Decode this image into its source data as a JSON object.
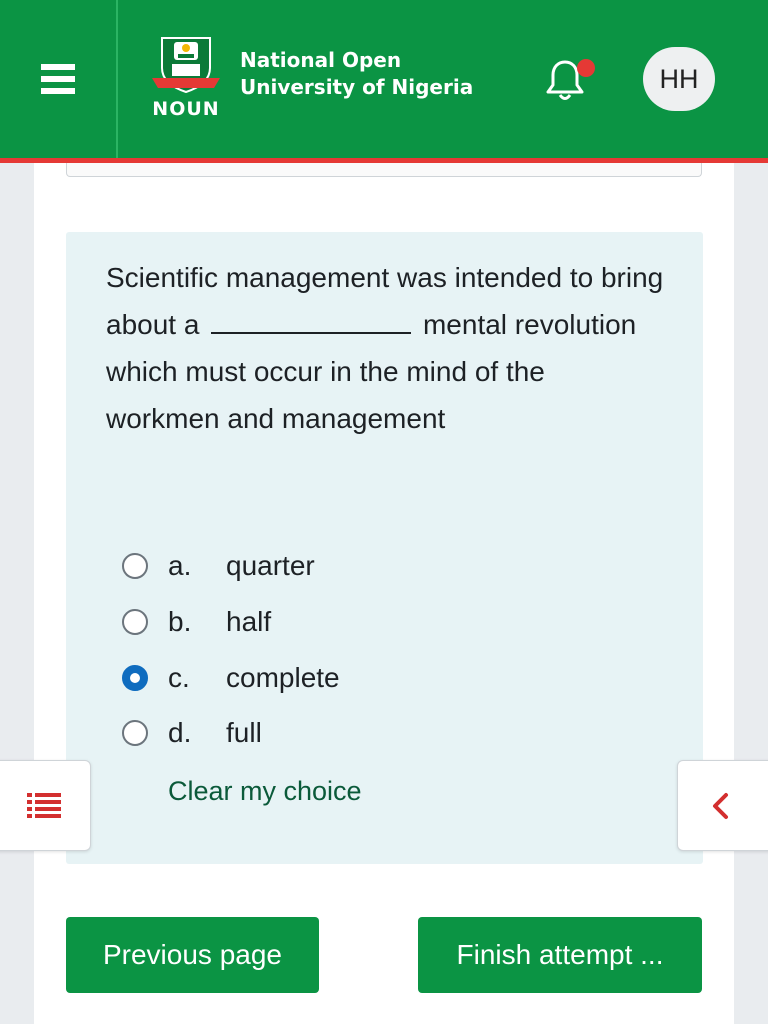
{
  "header": {
    "logo_text": "NOUN",
    "site_name_line1": "National Open",
    "site_name_line2": "University of Nigeria",
    "menu_icon": "hamburger-menu-icon",
    "notification_icon": "bell-icon",
    "user_initials": "HH",
    "colors": {
      "brand_green": "#0b9444",
      "accent_red": "#e53935"
    }
  },
  "question": {
    "text_before": "Scientific management was intended to bring about a",
    "text_after": "mental revolution which must occur in the mind of the workmen and management",
    "options": [
      {
        "letter": "a.",
        "label": "quarter",
        "selected": false
      },
      {
        "letter": "b.",
        "label": "half",
        "selected": false
      },
      {
        "letter": "c.",
        "label": "complete",
        "selected": true
      },
      {
        "letter": "d.",
        "label": "full",
        "selected": false
      }
    ],
    "clear_label": "Clear my choice"
  },
  "side_tabs": {
    "left_icon": "list-icon",
    "right_icon": "chevron-left-icon"
  },
  "buttons": {
    "previous_label": "Previous page",
    "finish_label": "Finish attempt ..."
  }
}
